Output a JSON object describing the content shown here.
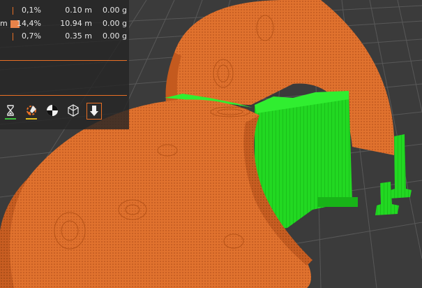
{
  "stats": [
    {
      "prefix": "",
      "pct": "0,1%",
      "length": "0.10 m",
      "weight": "0.00 g",
      "marker": "line"
    },
    {
      "prefix": "m",
      "pct": "14,4%",
      "length": "10.94 m",
      "weight": "0.00 g",
      "marker": "swatch"
    },
    {
      "prefix": "",
      "pct": "0,7%",
      "length": "0.35 m",
      "weight": "0.00 g",
      "marker": "line"
    }
  ],
  "toolbar": {
    "tools": [
      {
        "name": "hourglass-icon",
        "underline": "#3ec23e"
      },
      {
        "name": "paint-brush-icon",
        "underline": "#e0c020"
      },
      {
        "name": "color-wheel-icon",
        "underline": ""
      },
      {
        "name": "wireframe-cube-icon",
        "underline": ""
      },
      {
        "name": "download-arrow-icon",
        "underline": "",
        "selected": true
      }
    ]
  },
  "colors": {
    "accent": "#e86f24",
    "model": "#e07030",
    "support": "#22d822",
    "bed": "#3a3a3a",
    "grid": "#5a5a5a"
  }
}
